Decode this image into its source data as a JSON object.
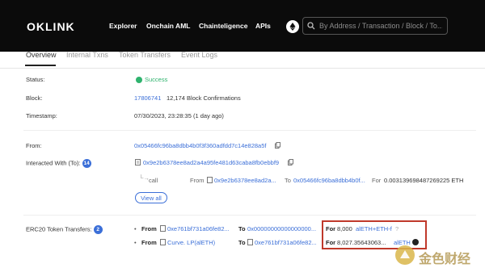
{
  "header": {
    "logo": "OKLINK",
    "nav": [
      "Explorer",
      "Onchain AML",
      "Chainteligence",
      "APIs"
    ],
    "search_placeholder": "By Address / Transaction / Block / To..."
  },
  "tabs": [
    "Overview",
    "Internal Txns",
    "Token Transfers",
    "Event Logs"
  ],
  "status": {
    "label": "Status:",
    "value": "Success"
  },
  "block": {
    "label": "Block:",
    "number": "17806741",
    "confirmations": "12,174 Block Confirmations"
  },
  "timestamp": {
    "label": "Timestamp:",
    "value": "07/30/2023, 23:28:35 (1 day ago)"
  },
  "from": {
    "label": "From:",
    "address": "0x05466fc96ba8dbb4b0f3f360adfdd7c14e828a5f"
  },
  "interacted": {
    "label": "Interacted With (To):",
    "count": "14",
    "address": "0x9e2b6378ee8ad2a4a95fe481d63caba8fb0ebbf9",
    "call": {
      "type": "call",
      "from_label": "From",
      "from": "0x9e2b6378ee8ad2a...",
      "to_label": "To",
      "to": "0x05466fc96ba8dbb4b0f...",
      "for_label": "For",
      "amount": "0.003139698487269225 ETH"
    },
    "view_all": "View all"
  },
  "erc20": {
    "label": "ERC20 Token Transfers:",
    "count": "2",
    "rows": [
      {
        "from_label": "From",
        "from": "0xe761bf731a06fe82...",
        "to_label": "To",
        "to": "0x00000000000000000...",
        "for_label": "For",
        "amount": "8,000",
        "token": "alETH+ETH-f"
      },
      {
        "from_label": "From",
        "from": "Curve. LP(alETH)",
        "to_label": "To",
        "to": "0xe761bf731a06fe82...",
        "for_label": "For",
        "amount": "8,027.35643063...",
        "token": "alETH"
      }
    ]
  },
  "watermark": "金色财经"
}
